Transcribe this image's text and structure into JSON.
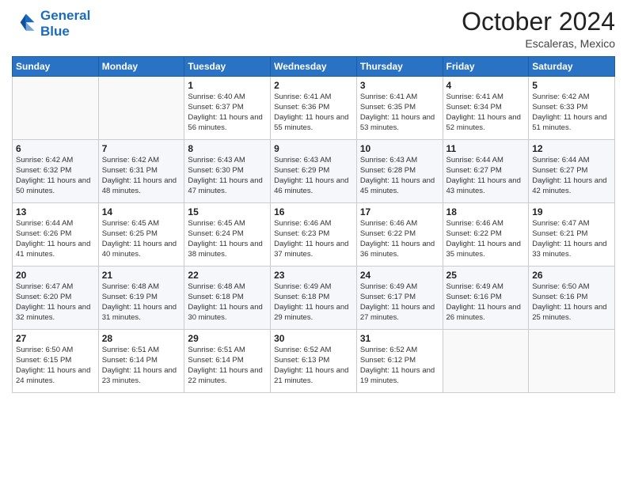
{
  "header": {
    "logo_line1": "General",
    "logo_line2": "Blue",
    "month": "October 2024",
    "location": "Escaleras, Mexico"
  },
  "weekdays": [
    "Sunday",
    "Monday",
    "Tuesday",
    "Wednesday",
    "Thursday",
    "Friday",
    "Saturday"
  ],
  "weeks": [
    [
      {
        "day": "",
        "info": ""
      },
      {
        "day": "",
        "info": ""
      },
      {
        "day": "1",
        "info": "Sunrise: 6:40 AM\nSunset: 6:37 PM\nDaylight: 11 hours and 56 minutes."
      },
      {
        "day": "2",
        "info": "Sunrise: 6:41 AM\nSunset: 6:36 PM\nDaylight: 11 hours and 55 minutes."
      },
      {
        "day": "3",
        "info": "Sunrise: 6:41 AM\nSunset: 6:35 PM\nDaylight: 11 hours and 53 minutes."
      },
      {
        "day": "4",
        "info": "Sunrise: 6:41 AM\nSunset: 6:34 PM\nDaylight: 11 hours and 52 minutes."
      },
      {
        "day": "5",
        "info": "Sunrise: 6:42 AM\nSunset: 6:33 PM\nDaylight: 11 hours and 51 minutes."
      }
    ],
    [
      {
        "day": "6",
        "info": "Sunrise: 6:42 AM\nSunset: 6:32 PM\nDaylight: 11 hours and 50 minutes."
      },
      {
        "day": "7",
        "info": "Sunrise: 6:42 AM\nSunset: 6:31 PM\nDaylight: 11 hours and 48 minutes."
      },
      {
        "day": "8",
        "info": "Sunrise: 6:43 AM\nSunset: 6:30 PM\nDaylight: 11 hours and 47 minutes."
      },
      {
        "day": "9",
        "info": "Sunrise: 6:43 AM\nSunset: 6:29 PM\nDaylight: 11 hours and 46 minutes."
      },
      {
        "day": "10",
        "info": "Sunrise: 6:43 AM\nSunset: 6:28 PM\nDaylight: 11 hours and 45 minutes."
      },
      {
        "day": "11",
        "info": "Sunrise: 6:44 AM\nSunset: 6:27 PM\nDaylight: 11 hours and 43 minutes."
      },
      {
        "day": "12",
        "info": "Sunrise: 6:44 AM\nSunset: 6:27 PM\nDaylight: 11 hours and 42 minutes."
      }
    ],
    [
      {
        "day": "13",
        "info": "Sunrise: 6:44 AM\nSunset: 6:26 PM\nDaylight: 11 hours and 41 minutes."
      },
      {
        "day": "14",
        "info": "Sunrise: 6:45 AM\nSunset: 6:25 PM\nDaylight: 11 hours and 40 minutes."
      },
      {
        "day": "15",
        "info": "Sunrise: 6:45 AM\nSunset: 6:24 PM\nDaylight: 11 hours and 38 minutes."
      },
      {
        "day": "16",
        "info": "Sunrise: 6:46 AM\nSunset: 6:23 PM\nDaylight: 11 hours and 37 minutes."
      },
      {
        "day": "17",
        "info": "Sunrise: 6:46 AM\nSunset: 6:22 PM\nDaylight: 11 hours and 36 minutes."
      },
      {
        "day": "18",
        "info": "Sunrise: 6:46 AM\nSunset: 6:22 PM\nDaylight: 11 hours and 35 minutes."
      },
      {
        "day": "19",
        "info": "Sunrise: 6:47 AM\nSunset: 6:21 PM\nDaylight: 11 hours and 33 minutes."
      }
    ],
    [
      {
        "day": "20",
        "info": "Sunrise: 6:47 AM\nSunset: 6:20 PM\nDaylight: 11 hours and 32 minutes."
      },
      {
        "day": "21",
        "info": "Sunrise: 6:48 AM\nSunset: 6:19 PM\nDaylight: 11 hours and 31 minutes."
      },
      {
        "day": "22",
        "info": "Sunrise: 6:48 AM\nSunset: 6:18 PM\nDaylight: 11 hours and 30 minutes."
      },
      {
        "day": "23",
        "info": "Sunrise: 6:49 AM\nSunset: 6:18 PM\nDaylight: 11 hours and 29 minutes."
      },
      {
        "day": "24",
        "info": "Sunrise: 6:49 AM\nSunset: 6:17 PM\nDaylight: 11 hours and 27 minutes."
      },
      {
        "day": "25",
        "info": "Sunrise: 6:49 AM\nSunset: 6:16 PM\nDaylight: 11 hours and 26 minutes."
      },
      {
        "day": "26",
        "info": "Sunrise: 6:50 AM\nSunset: 6:16 PM\nDaylight: 11 hours and 25 minutes."
      }
    ],
    [
      {
        "day": "27",
        "info": "Sunrise: 6:50 AM\nSunset: 6:15 PM\nDaylight: 11 hours and 24 minutes."
      },
      {
        "day": "28",
        "info": "Sunrise: 6:51 AM\nSunset: 6:14 PM\nDaylight: 11 hours and 23 minutes."
      },
      {
        "day": "29",
        "info": "Sunrise: 6:51 AM\nSunset: 6:14 PM\nDaylight: 11 hours and 22 minutes."
      },
      {
        "day": "30",
        "info": "Sunrise: 6:52 AM\nSunset: 6:13 PM\nDaylight: 11 hours and 21 minutes."
      },
      {
        "day": "31",
        "info": "Sunrise: 6:52 AM\nSunset: 6:12 PM\nDaylight: 11 hours and 19 minutes."
      },
      {
        "day": "",
        "info": ""
      },
      {
        "day": "",
        "info": ""
      }
    ]
  ]
}
